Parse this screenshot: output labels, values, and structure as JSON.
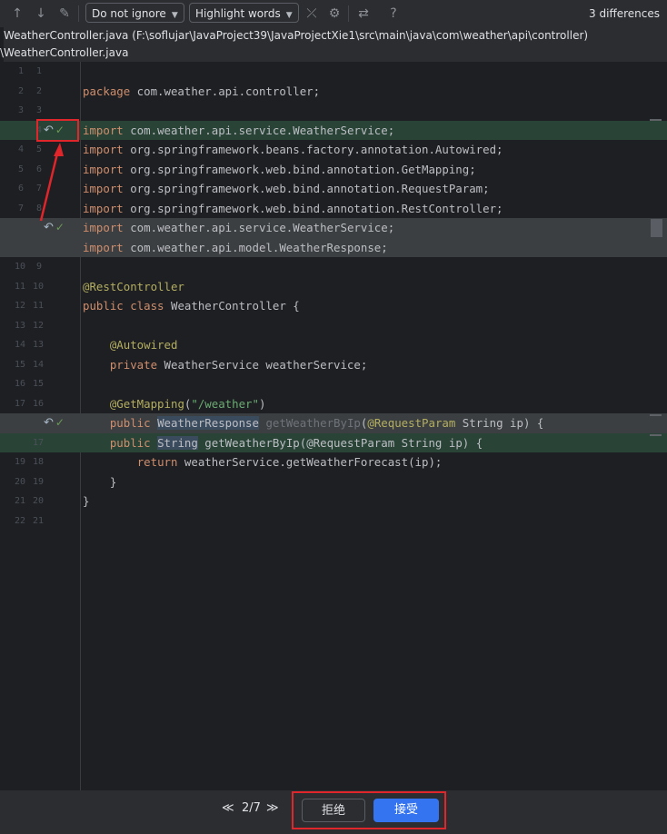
{
  "toolbar": {
    "up_icon": "↑",
    "down_icon": "↓",
    "edit_icon": "✎",
    "ignore_dropdown": "Do not ignore",
    "highlight_dropdown": "Highlight words",
    "collapse_icon": "⤫",
    "settings_icon": "⚙",
    "swap_icon": "⇄",
    "help_icon": "?",
    "differences": "3 differences"
  },
  "file_path": {
    "line1": "WeatherController.java (F:\\soflujar\\JavaProject39\\JavaProjectXie1\\src\\main\\java\\com\\weather\\api\\controller)",
    "line2": "\\WeatherController.java"
  },
  "lines": [
    {
      "l": "1",
      "r": "1",
      "code": ""
    },
    {
      "l": "2",
      "r": "2",
      "code": "package com.weather.api.controller;"
    },
    {
      "l": "3",
      "r": "3",
      "code": ""
    },
    {
      "l": "4",
      "r": "",
      "code": "import com.weather.api.service.WeatherService;"
    },
    {
      "l": "4",
      "r": "5",
      "code": "import org.springframework.beans.factory.annotation.Autowired;"
    },
    {
      "l": "5",
      "r": "6",
      "code": "import org.springframework.web.bind.annotation.GetMapping;"
    },
    {
      "l": "6",
      "r": "7",
      "code": "import org.springframework.web.bind.annotation.RequestParam;"
    },
    {
      "l": "7",
      "r": "8",
      "code": "import org.springframework.web.bind.annotation.RestController;"
    },
    {
      "l": "",
      "r": "",
      "code": "import com.weather.api.service.WeatherService;"
    },
    {
      "l": "",
      "r": "",
      "code": "import com.weather.api.model.WeatherResponse;"
    },
    {
      "l": "10",
      "r": "9",
      "code": ""
    },
    {
      "l": "11",
      "r": "10",
      "code": "@RestController"
    },
    {
      "l": "12",
      "r": "11",
      "code": "public class WeatherController {"
    },
    {
      "l": "13",
      "r": "12",
      "code": ""
    },
    {
      "l": "14",
      "r": "13",
      "code": "    @Autowired"
    },
    {
      "l": "15",
      "r": "14",
      "code": "    private WeatherService weatherService;"
    },
    {
      "l": "16",
      "r": "15",
      "code": ""
    },
    {
      "l": "17",
      "r": "16",
      "code": "    @GetMapping(\"/weather\")"
    },
    {
      "l": "",
      "r": "",
      "code": "    public WeatherResponse getWeatherByIp(@RequestParam String ip) {"
    },
    {
      "l": "",
      "r": "17",
      "code": "    public String getWeatherByIp(@RequestParam String ip) {"
    },
    {
      "l": "19",
      "r": "18",
      "code": "        return weatherService.getWeatherForecast(ip);"
    },
    {
      "l": "20",
      "r": "19",
      "code": "    }"
    },
    {
      "l": "21",
      "r": "20",
      "code": "}"
    },
    {
      "l": "22",
      "r": "21",
      "code": ""
    }
  ],
  "bottom": {
    "prev_icon": "≪",
    "counter": "2/7",
    "next_icon": "≫",
    "reject_label": "拒绝",
    "accept_label": "接受"
  },
  "colors": {
    "added_bg": "#294436",
    "removed_bg": "#3c3f41",
    "accent": "#3574f0",
    "highlight_red": "#e0252b"
  }
}
